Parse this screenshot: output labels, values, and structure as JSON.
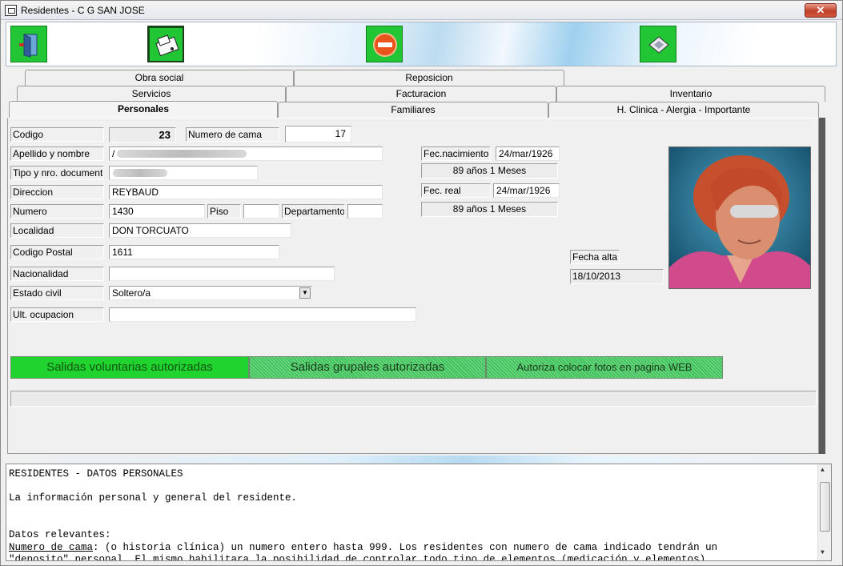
{
  "window": {
    "title": "Residentes - C G SAN JOSE",
    "close_label": "✕"
  },
  "toolbar": {
    "buttons": [
      {
        "icon": "exit-door-icon"
      },
      {
        "icon": "print-icon"
      },
      {
        "icon": "cancel-icon"
      },
      {
        "icon": "save-disk-icon"
      }
    ]
  },
  "tabs": {
    "row1": [
      "Obra social",
      "Reposicion"
    ],
    "row2": [
      "Servicios",
      "Facturacion",
      "Inventario"
    ],
    "row3": [
      "Personales",
      "Familiares",
      "H. Clinica - Alergia - Importante"
    ],
    "active": "Personales"
  },
  "form": {
    "codigo_label": "Codigo",
    "codigo_value": "23",
    "cama_label": "Numero de cama",
    "cama_value": "17",
    "apellido_label": "Apellido y nombre",
    "apellido_value": "/",
    "documento_label": "Tipo y nro. documento",
    "documento_value": "",
    "direccion_label": "Direccion",
    "direccion_value": "REYBAUD",
    "numero_label": "Numero",
    "numero_value": "1430",
    "piso_label": "Piso",
    "piso_value": "",
    "depto_label": "Departamento",
    "depto_value": "",
    "localidad_label": "Localidad",
    "localidad_value": "DON TORCUATO",
    "cp_label": "Codigo Postal",
    "cp_value": "1611",
    "nacionalidad_label": "Nacionalidad",
    "nacionalidad_value": "",
    "estado_label": "Estado civil",
    "estado_value": "Soltero/a",
    "ocupacion_label": "Ult. ocupacion",
    "ocupacion_value": "",
    "fec_nac_label": "Fec.nacimiento",
    "fec_nac_value": "24/mar/1926",
    "edad_1": "89 años 1 Meses",
    "fec_real_label": "Fec. real",
    "fec_real_value": "24/mar/1926",
    "edad_2": "89 años 1 Meses",
    "fecha_alta_label": "Fecha alta",
    "fecha_alta_value": "18/10/2013"
  },
  "authorizations": {
    "salidas_voluntarias": "Salidas voluntarias autorizadas",
    "salidas_grupales": "Salidas grupales autorizadas",
    "fotos_web": "Autoriza colocar fotos en pagina WEB"
  },
  "help": {
    "title": "RESIDENTES - DATOS PERSONALES",
    "intro": "La información personal y general del residente.",
    "relevant": "Datos relevantes:",
    "cama_term": "Numero de cama",
    "cama_desc": ": (o historia clínica) un numero entero hasta 999. Los residentes con numero de cama indicado tendrán un",
    "line_cut": "\"deposito\" personal. El mismo habilitara la posibilidad de controlar todo tipo de elementos (medicación y elementos)"
  }
}
